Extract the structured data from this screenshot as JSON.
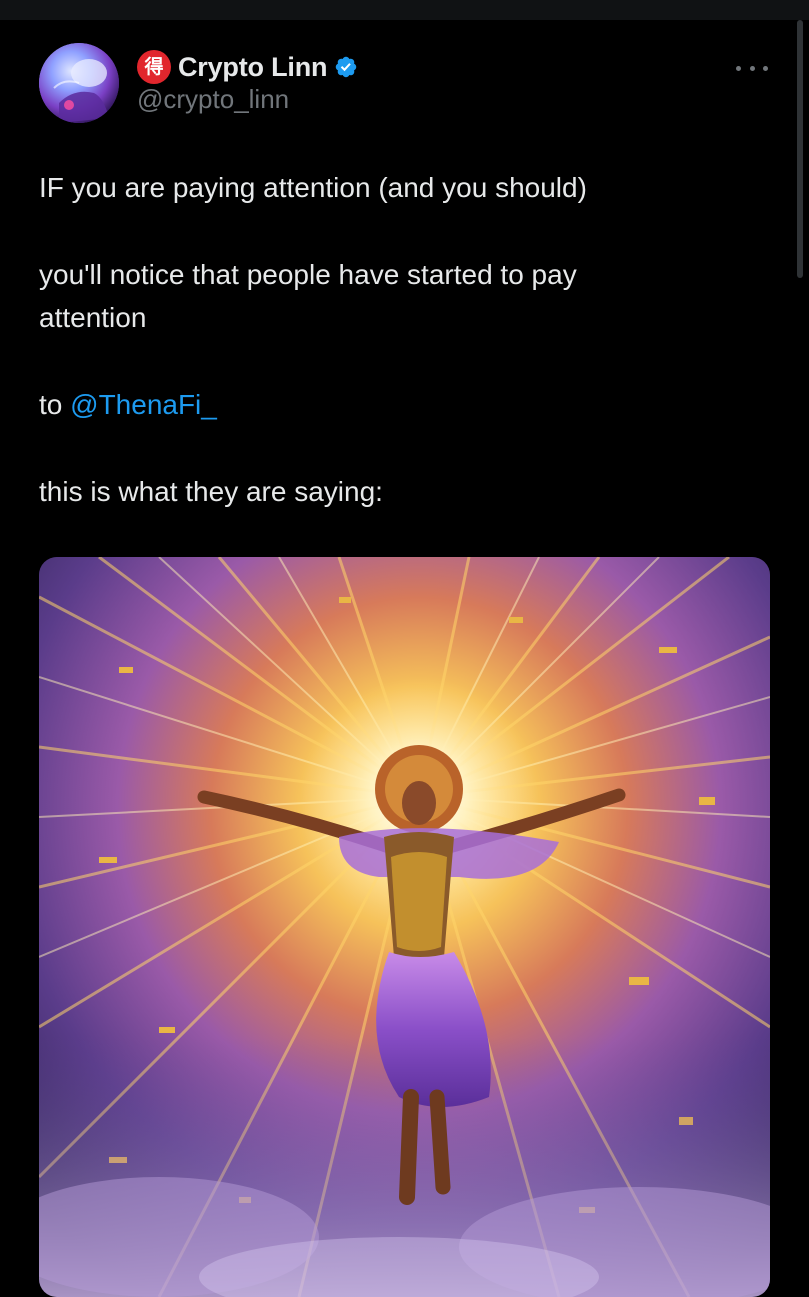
{
  "author": {
    "badge_glyph": "得",
    "display_name": "Crypto Linn",
    "handle": "@crypto_linn",
    "verified": true
  },
  "tweet": {
    "line1": "IF you are paying attention (and you should)",
    "line2": "you'll notice that people have started to pay",
    "line3": "attention",
    "line4_prefix": "to",
    "mention": "@ThenaFi_",
    "line5": "this is what they are saying:"
  },
  "media": {
    "subject": "golden-radiant-goddess-painting"
  },
  "icons": {
    "more": "more-horizontal-icon",
    "verified": "verified-badge-icon"
  },
  "colors": {
    "background": "#000000",
    "text": "#e7e9ea",
    "muted": "#71767b",
    "link": "#1d9bf0",
    "verified": "#1d9bf0",
    "badge": "#e1262d"
  }
}
